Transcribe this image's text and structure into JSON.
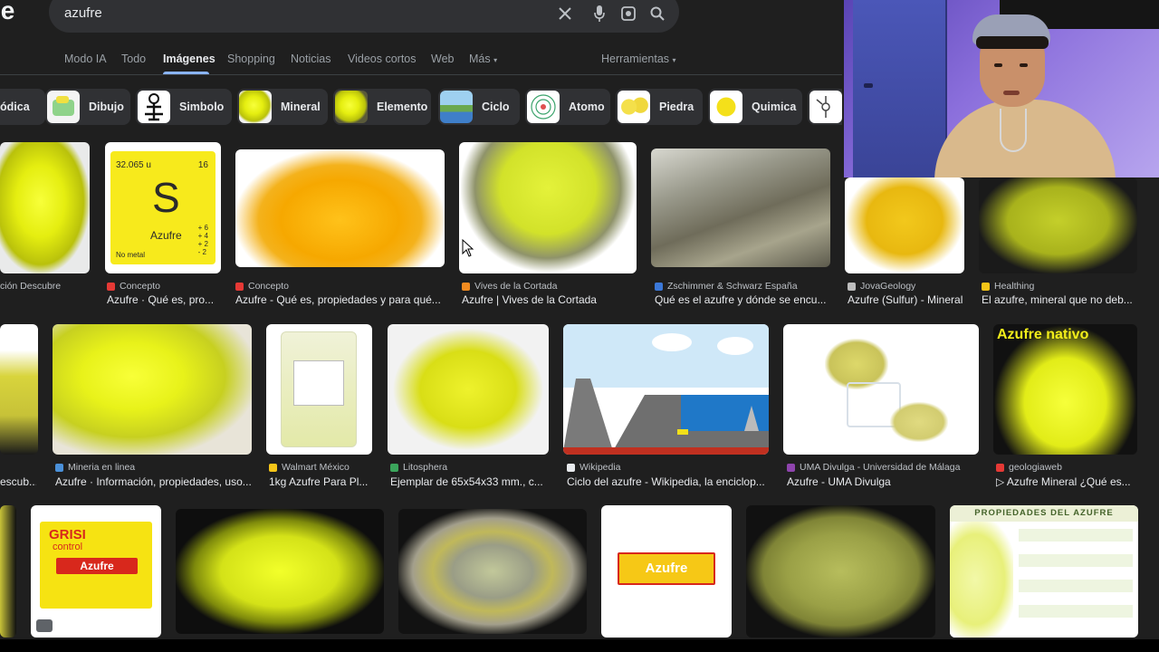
{
  "logo_text": "le",
  "search": {
    "query": "azufre"
  },
  "icons": {
    "clear": "close-icon",
    "voice": "microphone-icon",
    "lens": "camera-lens-icon",
    "search": "search-icon"
  },
  "tabs": [
    {
      "label": "Modo IA"
    },
    {
      "label": "Todo"
    },
    {
      "label": "Imágenes",
      "active": true
    },
    {
      "label": "Shopping"
    },
    {
      "label": "Noticias"
    },
    {
      "label": "Videos cortos"
    },
    {
      "label": "Web"
    },
    {
      "label": "Más"
    },
    {
      "label": "Herramientas"
    }
  ],
  "chips": [
    {
      "label": "ódica"
    },
    {
      "label": "Dibujo"
    },
    {
      "label": "Simbolo"
    },
    {
      "label": "Mineral"
    },
    {
      "label": "Elemento"
    },
    {
      "label": "Ciclo"
    },
    {
      "label": "Atomo"
    },
    {
      "label": "Piedra"
    },
    {
      "label": "Quimica"
    }
  ],
  "periodic_card": {
    "mass": "32.065 u",
    "number": "16",
    "symbol": "S",
    "name": "Azufre",
    "states": "+ 6\n+ 4\n+ 2\n- 2",
    "type": "No metal"
  },
  "results_row1": [
    {
      "source": "ción Descubre",
      "title": ""
    },
    {
      "source": "Concepto",
      "title": "Azufre · Qué es, pro..."
    },
    {
      "source": "Concepto",
      "title": "Azufre - Qué es, propiedades y para qué..."
    },
    {
      "source": "Vives de la Cortada",
      "title": "Azufre | Vives de la Cortada"
    },
    {
      "source": "Zschimmer & Schwarz España",
      "title": "Qué es el azufre y dónde se encu..."
    },
    {
      "source": "JovaGeology",
      "title": "Azufre (Sulfur) - Mineral"
    },
    {
      "source": "Healthing",
      "title": "El azufre, mineral que no deb..."
    }
  ],
  "results_row2": [
    {
      "source": "",
      "title": "escub..."
    },
    {
      "source": "Mineria en linea",
      "title": "Azufre · Información, propiedades, uso..."
    },
    {
      "source": "Walmart México",
      "title": "1kg Azufre Para Pl..."
    },
    {
      "source": "Litosphera",
      "title": "Ejemplar de 65x54x33 mm., c..."
    },
    {
      "source": "Wikipedia",
      "title": "Ciclo del azufre - Wikipedia, la enciclop..."
    },
    {
      "source": "UMA Divulga - Universidad de Málaga",
      "title": "Azufre - UMA Divulga"
    },
    {
      "source": "geologiaweb",
      "title": "▷ Azufre Mineral ¿Qué es..."
    }
  ],
  "overlay_texts": {
    "azufre_nativo": "Azufre nativo",
    "grisi_brand": "GRISI",
    "grisi_sub": "control",
    "grisi_name": "Azufre",
    "box_azufre": "Azufre",
    "prop_title": "PROPIEDADES DEL AZUFRE"
  },
  "colors": {
    "background": "#1f1f1f",
    "accent": "#8ab4f8",
    "sulfur": "#eef21a"
  }
}
